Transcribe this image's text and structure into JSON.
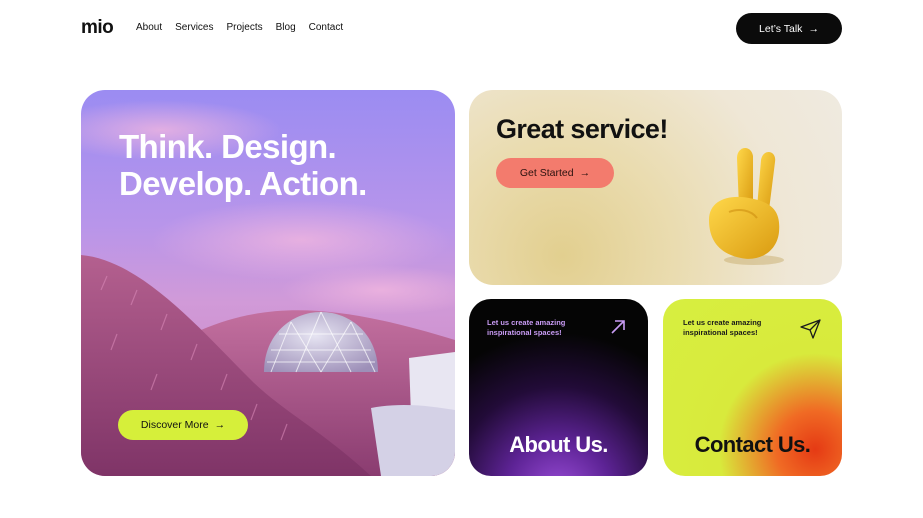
{
  "header": {
    "logo": "mio",
    "nav": [
      "About",
      "Services",
      "Projects",
      "Blog",
      "Contact"
    ],
    "cta_label": "Let’s Talk",
    "cta_arrow": "→"
  },
  "hero": {
    "title_line1": "Think. Design.",
    "title_line2": "Develop. Action.",
    "button_label": "Discover More",
    "button_arrow": "→"
  },
  "service": {
    "title": "Great service!",
    "button_label": "Get Started",
    "button_arrow": "→",
    "image_icon": "peace-hand-icon"
  },
  "about_card": {
    "tagline": "Let us create amazing inspirational spaces!",
    "heading": "About Us.",
    "icon": "arrow-up-right-icon"
  },
  "contact_card": {
    "tagline": "Let us create amazing inspirational spaces!",
    "heading": "Contact Us.",
    "icon": "send-icon"
  },
  "colors": {
    "accent_lime": "#d6ef3a",
    "accent_coral": "#f37b6d",
    "dark": "#0b0b0b",
    "purple": "#9a4dd8"
  }
}
